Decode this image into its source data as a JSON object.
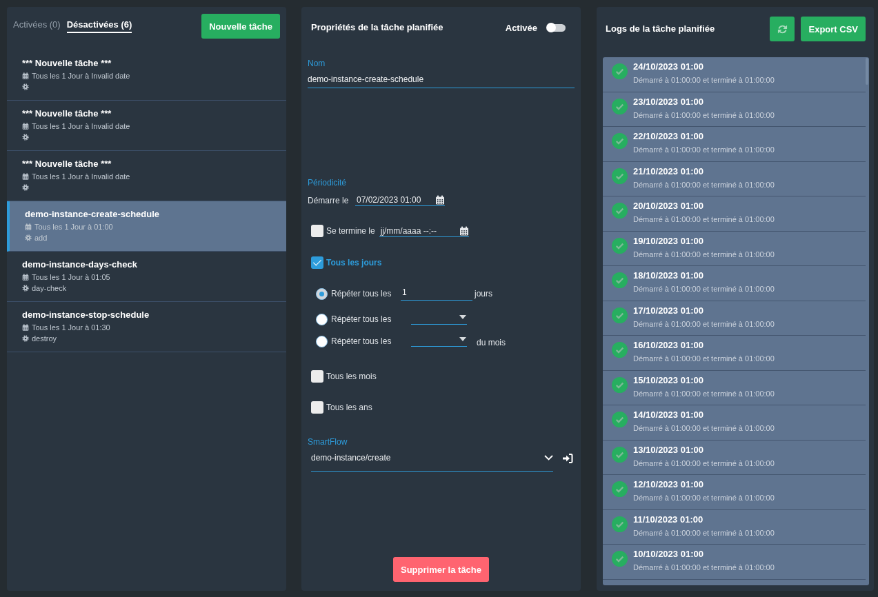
{
  "task_list": {
    "tabs": [
      {
        "label": "Activées (0)",
        "selected": false
      },
      {
        "label": "Désactivées (6)",
        "selected": true
      }
    ],
    "new_task_button": "Nouvelle tâche",
    "items": [
      {
        "title": "*** Nouvelle tâche ***",
        "schedule": "Tous les 1 Jour à Invalid date",
        "selected": false
      },
      {
        "title": "*** Nouvelle tâche ***",
        "schedule": "Tous les 1 Jour à Invalid date",
        "selected": false
      },
      {
        "title": "*** Nouvelle tâche ***",
        "schedule": "Tous les 1 Jour à Invalid date",
        "selected": false
      },
      {
        "title": "demo-instance-create-schedule",
        "schedule": "Tous les 1 Jour à 01:00",
        "action": "add",
        "selected": true
      },
      {
        "title": "demo-instance-days-check",
        "schedule": "Tous les 1 Jour à 01:05",
        "action": "day-check",
        "selected": false
      },
      {
        "title": "demo-instance-stop-schedule",
        "schedule": "Tous les 1 Jour à 01:30",
        "action": "destroy",
        "selected": false
      }
    ]
  },
  "properties": {
    "title": "Propriétés de la tâche planifiée",
    "enabled_toggle": {
      "label": "Activée",
      "on": false
    },
    "name_field": {
      "label": "Nom",
      "value": "demo-instance-create-schedule"
    },
    "periodicity": {
      "label": "Périodicité",
      "start": {
        "label": "Démarre le",
        "value": "07/02/2023 01:00"
      },
      "end": {
        "label": "Se termine le",
        "placeholder": "jj/mm/aaaa --:--",
        "checked": false
      }
    },
    "daily": {
      "label": "Tous les jours",
      "checked": true,
      "options": [
        {
          "kind": "input",
          "label": "Répéter tous les",
          "value": "1",
          "suffix": "jours",
          "selected": true
        },
        {
          "kind": "select",
          "label": "Répéter tous les",
          "selected": false
        },
        {
          "kind": "select",
          "label": "Répéter tous les",
          "suffix": "du mois",
          "selected": false
        }
      ]
    },
    "monthly": {
      "label": "Tous les mois",
      "checked": false
    },
    "yearly": {
      "label": "Tous les ans",
      "checked": false
    },
    "smartflow": {
      "label": "SmartFlow",
      "value": "demo-instance/create"
    },
    "delete_button": "Supprimer la tâche"
  },
  "logs": {
    "title": "Logs de la tâche planifiée",
    "export_button": "Export CSV",
    "entries": [
      {
        "date": "24/10/2023 01:00",
        "detail": "Démarré à 01:00:00 et terminé à 01:00:00",
        "succeeded": true
      },
      {
        "date": "23/10/2023 01:00",
        "detail": "Démarré à 01:00:00 et terminé à 01:00:00",
        "succeeded": true
      },
      {
        "date": "22/10/2023 01:00",
        "detail": "Démarré à 01:00:00 et terminé à 01:00:00",
        "succeeded": true
      },
      {
        "date": "21/10/2023 01:00",
        "detail": "Démarré à 01:00:00 et terminé à 01:00:00",
        "succeeded": true
      },
      {
        "date": "20/10/2023 01:00",
        "detail": "Démarré à 01:00:00 et terminé à 01:00:00",
        "succeeded": true
      },
      {
        "date": "19/10/2023 01:00",
        "detail": "Démarré à 01:00:00 et terminé à 01:00:00",
        "succeeded": true
      },
      {
        "date": "18/10/2023 01:00",
        "detail": "Démarré à 01:00:00 et terminé à 01:00:00",
        "succeeded": true
      },
      {
        "date": "17/10/2023 01:00",
        "detail": "Démarré à 01:00:00 et terminé à 01:00:00",
        "succeeded": true
      },
      {
        "date": "16/10/2023 01:00",
        "detail": "Démarré à 01:00:00 et terminé à 01:00:00",
        "succeeded": true
      },
      {
        "date": "15/10/2023 01:00",
        "detail": "Démarré à 01:00:00 et terminé à 01:00:00",
        "succeeded": true
      },
      {
        "date": "14/10/2023 01:00",
        "detail": "Démarré à 01:00:00 et terminé à 01:00:00",
        "succeeded": true
      },
      {
        "date": "13/10/2023 01:00",
        "detail": "Démarré à 01:00:00 et terminé à 01:00:00",
        "succeeded": true
      },
      {
        "date": "12/10/2023 01:00",
        "detail": "Démarré à 01:00:00 et terminé à 01:00:00",
        "succeeded": true
      },
      {
        "date": "11/10/2023 01:00",
        "detail": "Démarré à 01:00:00 et terminé à 01:00:00",
        "succeeded": true
      },
      {
        "date": "10/10/2023 01:00",
        "detail": "Démarré à 01:00:00 et terminé à 01:00:00",
        "succeeded": true
      }
    ]
  }
}
